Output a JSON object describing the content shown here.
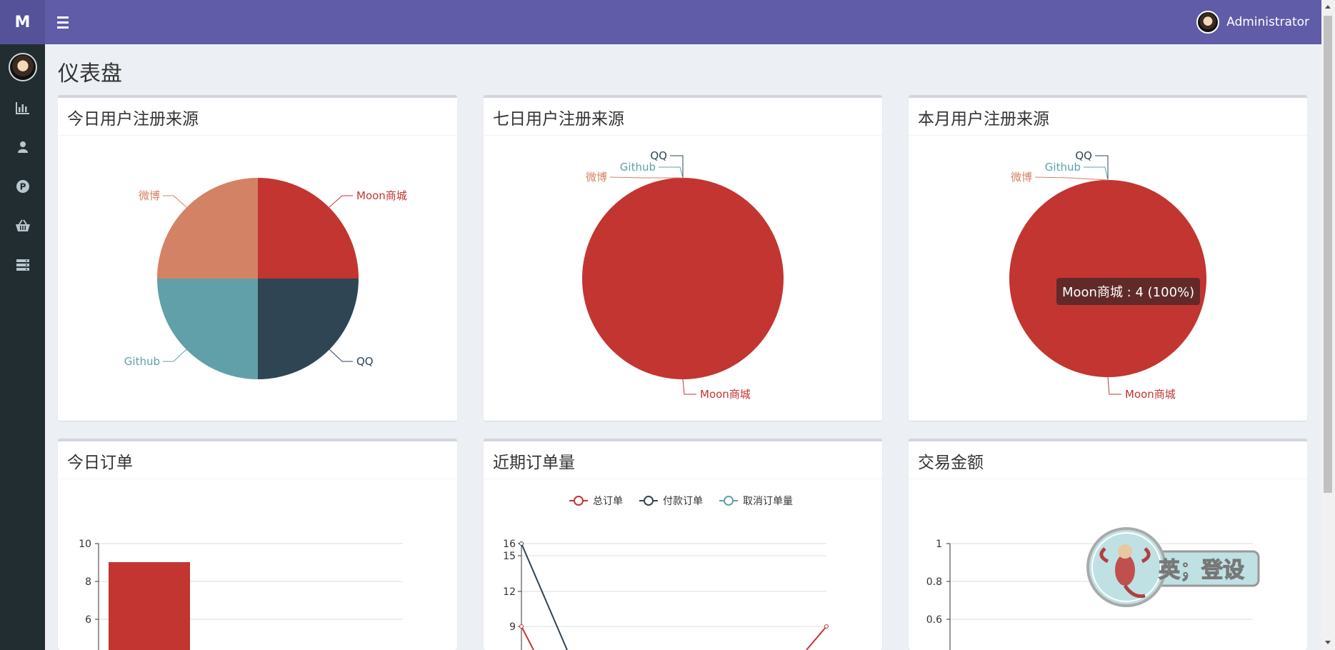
{
  "header": {
    "logo": "M",
    "username": "Administrator"
  },
  "sidebar": {
    "items": [
      {
        "icon": "bar-chart-icon"
      },
      {
        "icon": "user-icon"
      },
      {
        "icon": "p-circle-icon"
      },
      {
        "icon": "basket-icon"
      },
      {
        "icon": "server-icon"
      }
    ]
  },
  "page": {
    "title": "仪表盘"
  },
  "cards": {
    "today_reg": {
      "title": "今日用户注册来源"
    },
    "week_reg": {
      "title": "七日用户注册来源"
    },
    "month_reg": {
      "title": "本月用户注册来源"
    },
    "today_orders": {
      "title": "今日订单"
    },
    "recent_orders": {
      "title": "近期订单量"
    },
    "trade_amount": {
      "title": "交易金额"
    }
  },
  "tooltip": {
    "text": "Moon商城 : 4 (100%)"
  },
  "colors": {
    "header": "#605ca8",
    "sidebar": "#222d32",
    "red": "#c23531",
    "navy": "#2f4554",
    "teal": "#61a0a8",
    "orange": "#d48265"
  },
  "chart_data": [
    {
      "type": "pie",
      "title": "今日用户注册来源",
      "labels": [
        "Moon商城",
        "QQ",
        "Github",
        "微博"
      ],
      "values": [
        1,
        1,
        1,
        1
      ],
      "colors": [
        "#c23531",
        "#2f4554",
        "#61a0a8",
        "#d48265"
      ]
    },
    {
      "type": "pie",
      "title": "七日用户注册来源",
      "labels": [
        "Moon商城",
        "QQ",
        "Github",
        "微博"
      ],
      "values": [
        1,
        0,
        0,
        0
      ],
      "colors": [
        "#c23531",
        "#2f4554",
        "#61a0a8",
        "#d48265"
      ]
    },
    {
      "type": "pie",
      "title": "本月用户注册来源",
      "labels": [
        "Moon商城",
        "QQ",
        "Github",
        "微博"
      ],
      "values": [
        4,
        0,
        0,
        0
      ],
      "colors": [
        "#c23531",
        "#2f4554",
        "#61a0a8",
        "#d48265"
      ]
    },
    {
      "type": "bar",
      "title": "今日订单",
      "yticks": [
        "10",
        "8",
        "6"
      ],
      "values": [
        9
      ]
    },
    {
      "type": "line",
      "title": "近期订单量",
      "legend": [
        "总订单",
        "付款订单",
        "取消订单量"
      ],
      "yticks": [
        "16",
        "15",
        "12",
        "9"
      ],
      "series": [
        {
          "name": "总订单",
          "color": "#c23531",
          "first_value": 9,
          "last_value": 9
        },
        {
          "name": "付款订单",
          "color": "#2f4554",
          "first_value": 16
        },
        {
          "name": "取消订单量",
          "color": "#61a0a8"
        }
      ]
    },
    {
      "type": "line",
      "title": "交易金额",
      "yticks": [
        "1",
        "0.8",
        "0.6"
      ]
    }
  ]
}
